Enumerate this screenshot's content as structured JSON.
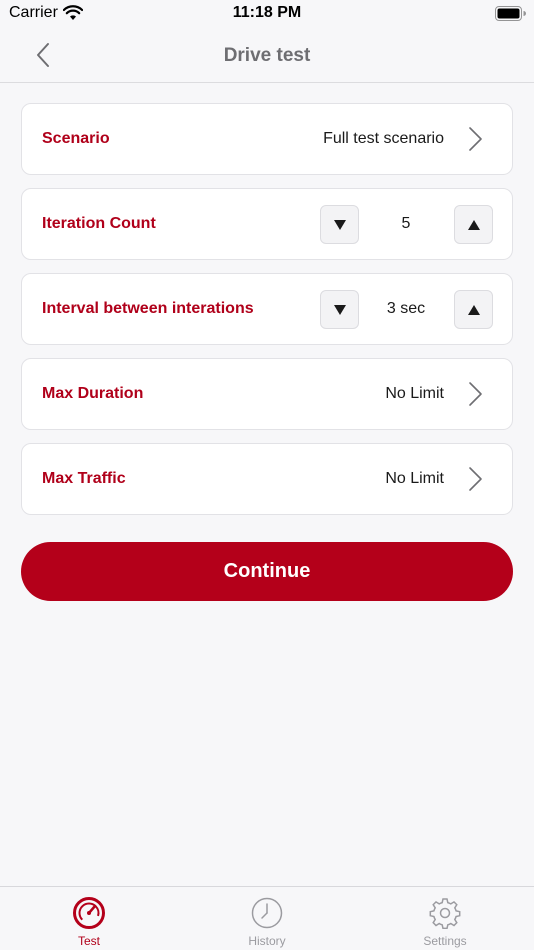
{
  "status_bar": {
    "carrier": "Carrier",
    "time": "11:18 PM"
  },
  "nav": {
    "title": "Drive test",
    "back_icon": "chevron-left-icon"
  },
  "rows": {
    "scenario": {
      "label": "Scenario",
      "value": "Full test scenario"
    },
    "iteration_count": {
      "label": "Iteration Count",
      "value": "5"
    },
    "interval": {
      "label": "Interval between interations",
      "value": "3 sec"
    },
    "max_duration": {
      "label": "Max Duration",
      "value": "No Limit"
    },
    "max_traffic": {
      "label": "Max Traffic",
      "value": "No Limit"
    }
  },
  "continue_label": "Continue",
  "tabs": [
    {
      "label": "Test",
      "icon": "speedometer-icon",
      "active": true
    },
    {
      "label": "History",
      "icon": "clock-icon",
      "active": false
    },
    {
      "label": "Settings",
      "icon": "gear-icon",
      "active": false
    }
  ],
  "colors": {
    "accent": "#b4001a",
    "label_red": "#b0001a",
    "background": "#f7f7f9",
    "inactive": "#9b9ba0"
  }
}
